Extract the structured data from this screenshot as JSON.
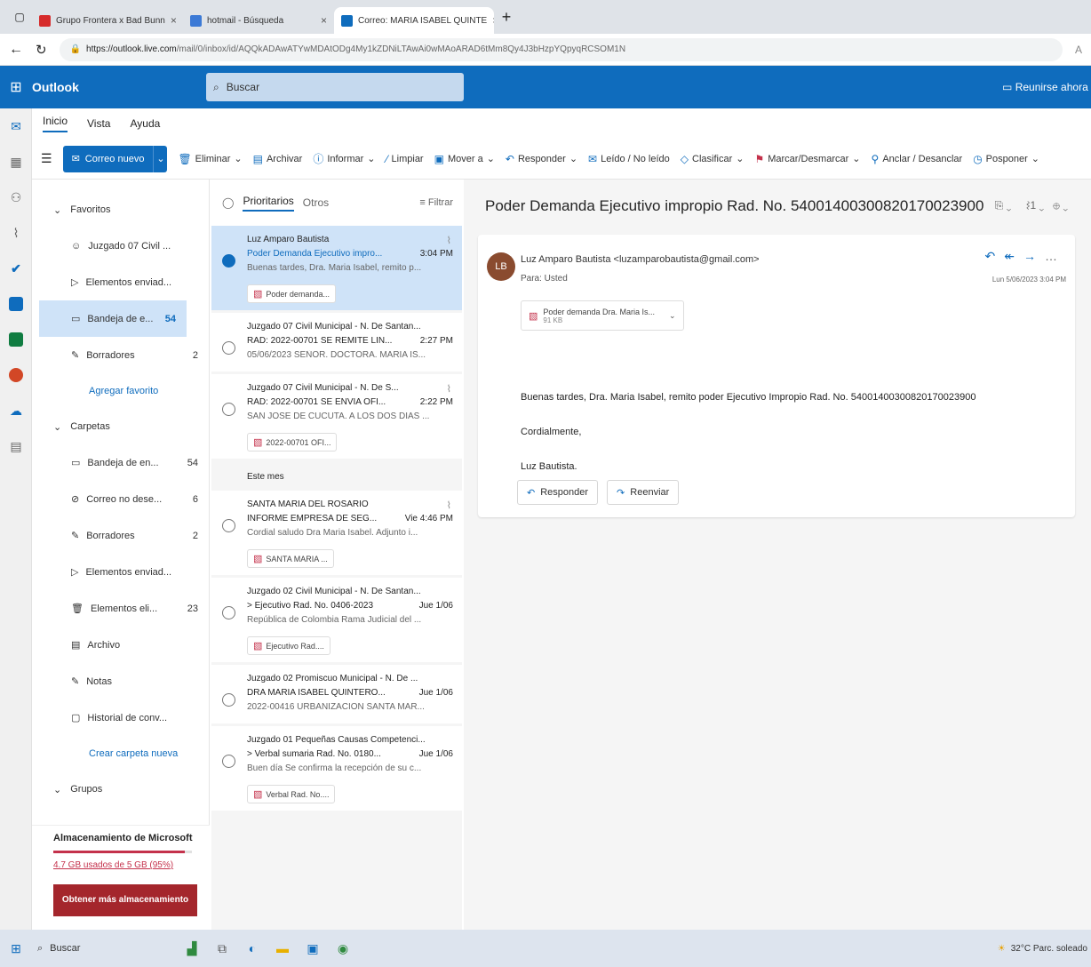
{
  "browser": {
    "tabs": [
      {
        "label": "Grupo Frontera x Bad Bunn",
        "color": "#d62b2b"
      },
      {
        "label": "hotmail - Búsqueda",
        "color": "#3c7ad6"
      },
      {
        "label": "Correo: MARIA ISABEL QUINTE",
        "color": "#0f6cbd"
      }
    ],
    "url_host": "https://outlook.live.com",
    "url_path": "/mail/0/inbox/id/AQQkADAwATYwMDAtODg4My1kZDNiLTAwAi0wMAoARAD6tMm8Qy4J3bHzpYQpyqRCSOM1N"
  },
  "outlook": {
    "app_title": "Outlook",
    "search_placeholder": "Buscar",
    "header_right": "Reunirse ahora"
  },
  "ribbon": {
    "tabs": [
      "Inicio",
      "Vista",
      "Ayuda"
    ],
    "new_mail": "Correo nuevo",
    "buttons": [
      "Eliminar",
      "Archivar",
      "Informar",
      "Limpiar",
      "Mover a",
      "Responder",
      "Leído / No leído",
      "Clasificar",
      "Marcar/Desmarcar",
      "Anclar / Desanclar",
      "Posponer"
    ]
  },
  "folders": {
    "favorites_label": "Favoritos",
    "favorites": [
      {
        "name": "Juzgado 07 Civil ...",
        "count": ""
      },
      {
        "name": "Elementos enviad...",
        "count": ""
      },
      {
        "name": "Bandeja de e...",
        "count": "54"
      },
      {
        "name": "Borradores",
        "count": "2"
      }
    ],
    "add_favorite": "Agregar favorito",
    "folders_label": "Carpetas",
    "folders": [
      {
        "name": "Bandeja de en...",
        "count": "54"
      },
      {
        "name": "Correo no dese...",
        "count": "6"
      },
      {
        "name": "Borradores",
        "count": "2"
      },
      {
        "name": "Elementos enviad...",
        "count": ""
      },
      {
        "name": "Elementos eli...",
        "count": "23"
      },
      {
        "name": "Archivo",
        "count": ""
      },
      {
        "name": "Notas",
        "count": ""
      },
      {
        "name": "Historial de conv...",
        "count": ""
      }
    ],
    "create_folder": "Crear carpeta nueva",
    "groups_label": "Grupos"
  },
  "storage": {
    "title": "Almacenamiento de Microsoft",
    "used_text": "4.7 GB usados de 5 GB (95%)",
    "usage_fraction": 0.95,
    "button": "Obtener más almacenamiento"
  },
  "message_list": {
    "tab_focused": "Prioritarios",
    "tab_other": "Otros",
    "filter": "Filtrar",
    "section_label": "Este mes",
    "messages": [
      {
        "sender": "Luz Amparo Bautista",
        "subject": "Poder Demanda Ejecutivo impro...",
        "time": "3:04 PM",
        "preview": "Buenas tardes, Dra. Maria Isabel, remito p...",
        "attachment": "Poder demanda..."
      },
      {
        "sender": "Juzgado 07 Civil Municipal - N. De Santan...",
        "subject": "RAD: 2022-00701 SE REMITE LIN...",
        "time": "2:27 PM",
        "preview": "05/06/2023 SEÑOR. DOCTORA. MARIA IS...",
        "attachment": ""
      },
      {
        "sender": "Juzgado 07 Civil Municipal - N. De S...",
        "subject": "RAD: 2022-00701 SE ENVIA OFI...",
        "time": "2:22 PM",
        "preview": "SAN JOSE DE CUCUTA. A LOS DOS DIAS ...",
        "attachment": "2022-00701 OFI..."
      },
      {
        "sender": "SANTA MARIA DEL ROSARIO",
        "subject": "INFORME EMPRESA DE SEG...",
        "time": "Vie 4:46 PM",
        "preview": "Cordial saludo Dra Maria Isabel. Adjunto i...",
        "attachment": "SANTA MARIA ..."
      },
      {
        "sender": "Juzgado 02 Civil Municipal - N. De Santan...",
        "subject": "> Ejecutivo Rad. No. 0406-2023",
        "time": "Jue 1/06",
        "preview": "República de Colombia Rama Judicial del ...",
        "attachment": "Ejecutivo Rad...."
      },
      {
        "sender": "Juzgado 02 Promiscuo Municipal - N. De ...",
        "subject": "DRA MARIA ISABEL QUINTERO...",
        "time": "Jue 1/06",
        "preview": "2022-00416 URBANIZACION SANTA MAR...",
        "attachment": ""
      },
      {
        "sender": "Juzgado 01 Pequeñas Causas Competenci...",
        "subject": "> Verbal sumaria Rad. No. 0180...",
        "time": "Jue 1/06",
        "preview": "Buen día Se confirma la recepción de su c...",
        "attachment": "Verbal Rad. No...."
      }
    ]
  },
  "reading": {
    "subject": "Poder Demanda Ejecutivo impropio Rad. No. 54001400300820170023900",
    "avatar_initials": "LB",
    "avatar_color": "#8a4b2f",
    "from": "Luz Amparo Bautista <luzamparobautista@gmail.com>",
    "to": "Para: Usted",
    "date": "Lun 5/06/2023 3:04 PM",
    "attachment_name": "Poder demanda Dra. Maria Is...",
    "attachment_size": "91 KB",
    "body_lines": [
      "Buenas tardes, Dra. Maria Isabel, remito poder Ejecutivo Impropio Rad. No. 54001400300820170023900",
      "Cordialmente,",
      "Luz Bautista."
    ],
    "reply": "Responder",
    "forward": "Reenviar"
  },
  "taskbar": {
    "search": "Buscar",
    "weather": "32°C  Parc. soleado"
  }
}
